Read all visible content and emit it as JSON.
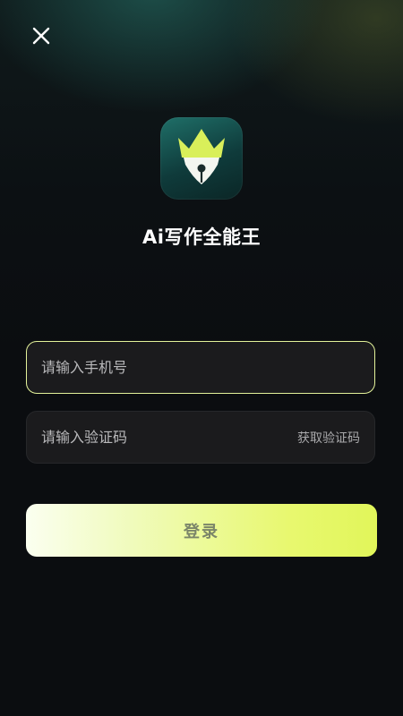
{
  "header": {
    "close_icon": "close-icon"
  },
  "app": {
    "icon": "crown-pen-icon",
    "title": "Ai写作全能王"
  },
  "form": {
    "phone": {
      "placeholder": "请输入手机号",
      "value": ""
    },
    "code": {
      "placeholder": "请输入验证码",
      "value": "",
      "get_code_label": "获取验证码"
    },
    "login_label": "登录"
  },
  "colors": {
    "accent": "#e3f29a",
    "background": "#0b0d10",
    "field_bg": "#1b1b1d",
    "button_start": "#fbfff0",
    "button_end": "#e1f65a"
  }
}
